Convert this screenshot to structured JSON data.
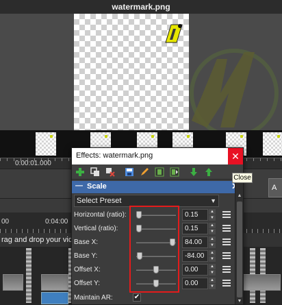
{
  "preview": {
    "title": "watermark.png"
  },
  "timeline": {
    "timecode_1": "0:00:01.000",
    "timecode_ruler_left": "00",
    "timecode_ruler_mid": "0:04:00",
    "drag_hint": "rag and drop your vide",
    "right_button_label": "A"
  },
  "dialog": {
    "title": "Effects: watermark.png",
    "close_symbol": "✕",
    "close_tooltip": "Close",
    "toolbar": [
      {
        "name": "add-effect-icon",
        "color": "#3cb043"
      },
      {
        "name": "duplicate-effect-icon",
        "color": "#e0e0e0"
      },
      {
        "name": "remove-effect-icon",
        "color": "#e0473c"
      },
      {
        "name": "save-preset-icon",
        "color": "#4f8de0"
      },
      {
        "name": "edit-icon",
        "color": "#f0a030"
      },
      {
        "name": "film-icon",
        "color": "#6ab04c"
      },
      {
        "name": "film-export-icon",
        "color": "#6ab04c"
      },
      {
        "name": "move-down-icon",
        "color": "#3cb043"
      },
      {
        "name": "move-up-icon",
        "color": "#3cb043"
      }
    ],
    "scale": {
      "collapse_symbol": "—",
      "title": "Scale",
      "close_symbol": "✕",
      "preset": "Select Preset",
      "preset_arrow": "▼",
      "params": [
        {
          "label": "Horizontal (ratio):",
          "value": "0.15",
          "slider_fraction": 0.07
        },
        {
          "label": "Vertical (ratio):",
          "value": "0.15",
          "slider_fraction": 0.07
        },
        {
          "label": "Base X:",
          "value": "84.00",
          "slider_fraction": 0.92
        },
        {
          "label": "Base Y:",
          "value": "-84.00",
          "slider_fraction": 0.08
        },
        {
          "label": "Offset X:",
          "value": "0.00",
          "slider_fraction": 0.5
        },
        {
          "label": "Offset Y:",
          "value": "0.00",
          "slider_fraction": 0.5
        }
      ],
      "maintain_ar_label": "Maintain AR:",
      "maintain_ar_checked": "✔"
    }
  }
}
